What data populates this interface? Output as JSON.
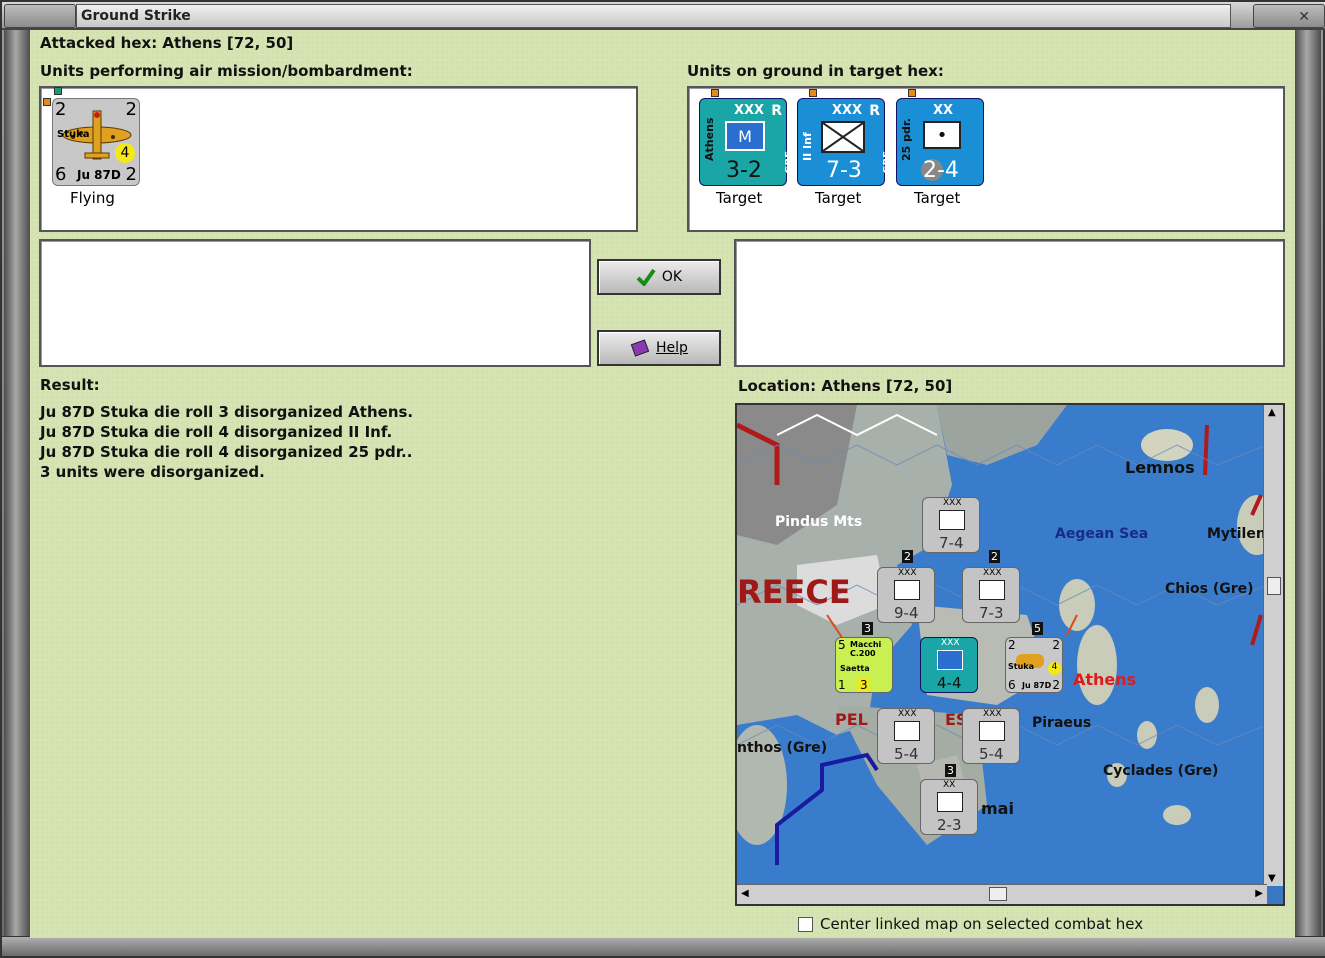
{
  "window": {
    "title": "Ground Strike"
  },
  "header": {
    "attacked_hex": "Attacked hex: Athens  [72, 50]"
  },
  "air_units": {
    "label": "Units performing air mission/bombardment:",
    "items": [
      {
        "top_left": "2",
        "top_right": "2",
        "name_tag": "Stuka",
        "badge": "4",
        "bottom_left": "6",
        "type": "Ju 87D",
        "bottom_right": "2",
        "status": "Flying"
      }
    ]
  },
  "ground_units": {
    "label": "Units on ground in target hex:",
    "items": [
      {
        "echelon": "XXX",
        "flag": "R",
        "side_name": "Athens",
        "side_right": "GRE",
        "symbol": "M",
        "strength": "3-2",
        "status": "Target",
        "color": "#1aa6a6"
      },
      {
        "echelon": "XXX",
        "flag": "R",
        "side_name": "II Inf",
        "side_right": "GRE",
        "symbol": "X",
        "strength": "7-3",
        "status": "Target",
        "color": "#1a8fd6"
      },
      {
        "echelon": "XX",
        "flag": "",
        "side_name": "25 pdr.",
        "side_right": "",
        "symbol": "•",
        "strength": "2-4",
        "status": "Target",
        "color": "#1a8fd6"
      }
    ]
  },
  "buttons": {
    "ok": "OK",
    "help": "Help"
  },
  "result": {
    "label": "Result:",
    "lines": [
      "Ju 87D Stuka die roll 3 disorganized Athens.",
      "Ju 87D Stuka die roll 4 disorganized II Inf.",
      "Ju 87D Stuka die roll 4 disorganized 25 pdr..",
      "3 units were disorganized."
    ]
  },
  "location": {
    "label": "Location:  Athens  [72, 50]"
  },
  "map": {
    "labels": {
      "lemnos": "Lemnos",
      "aegean": "Aegean Sea",
      "mytilene": "Mytilen",
      "chios": "Chios (Gre)",
      "pindus": "Pindus Mts",
      "greece": "REECE",
      "athens": "Athens",
      "piraeus": "Piraeus",
      "corinthos": "nthos (Gre)",
      "cyclades": "Cyclades (Gre)",
      "pelo": "PEL",
      "pelo2": "ES",
      "kalamai": "mai"
    },
    "counters": [
      {
        "strength": "7-4",
        "echelon": "XXX"
      },
      {
        "strength": "9-4",
        "echelon": "XXX",
        "stack": "2"
      },
      {
        "strength": "7-3",
        "echelon": "XXX",
        "stack": "2"
      },
      {
        "strength": "4-4",
        "echelon": "XXX"
      },
      {
        "strength": "5-4",
        "echelon": "XXX"
      },
      {
        "strength": "5-4",
        "echelon": "XXX"
      },
      {
        "strength": "2-3",
        "echelon": "XX",
        "stack": "3"
      },
      {
        "name": "Macchi C.200",
        "sub": "Saetta",
        "tl": "5",
        "bl": "1",
        "br": "3",
        "stack": "3"
      },
      {
        "name": "Stuka",
        "sub": "Ju 87D",
        "tl": "2",
        "tr": "2",
        "bl": "6",
        "br": "2",
        "badge": "4",
        "stack": "5"
      }
    ]
  },
  "footer": {
    "center_checkbox": "Center linked map on selected combat hex"
  }
}
